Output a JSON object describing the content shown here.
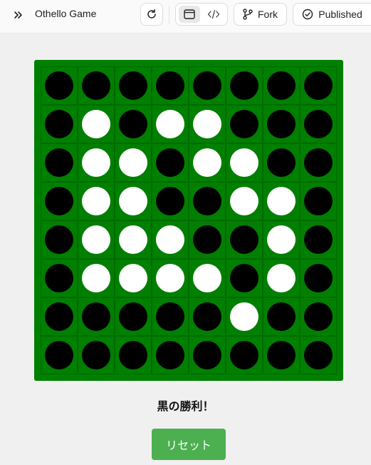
{
  "header": {
    "title": "Othello Game",
    "fork_label": "Fork",
    "published_label": "Published",
    "icons": [
      "chevrons-right-icon",
      "reload-icon",
      "preview-icon",
      "code-icon",
      "fork-icon",
      "check-circle-icon"
    ]
  },
  "board": {
    "colors": {
      "board": "#008000",
      "black": "#000000",
      "white": "#ffffff"
    },
    "rows": [
      [
        "b",
        "b",
        "b",
        "b",
        "b",
        "b",
        "b",
        "b"
      ],
      [
        "b",
        "w",
        "b",
        "w",
        "w",
        "b",
        "b",
        "b"
      ],
      [
        "b",
        "w",
        "w",
        "b",
        "w",
        "w",
        "b",
        "b"
      ],
      [
        "b",
        "w",
        "w",
        "b",
        "b",
        "w",
        "w",
        "b"
      ],
      [
        "b",
        "w",
        "w",
        "w",
        "b",
        "b",
        "w",
        "b"
      ],
      [
        "b",
        "w",
        "w",
        "w",
        "w",
        "b",
        "w",
        "b"
      ],
      [
        "b",
        "b",
        "b",
        "b",
        "b",
        "w",
        "b",
        "b"
      ],
      [
        "b",
        "b",
        "b",
        "b",
        "b",
        "b",
        "b",
        "b"
      ]
    ]
  },
  "status": "黒の勝利！",
  "reset_label": "リセット",
  "colors": {
    "reset_button": "#4caf50"
  }
}
